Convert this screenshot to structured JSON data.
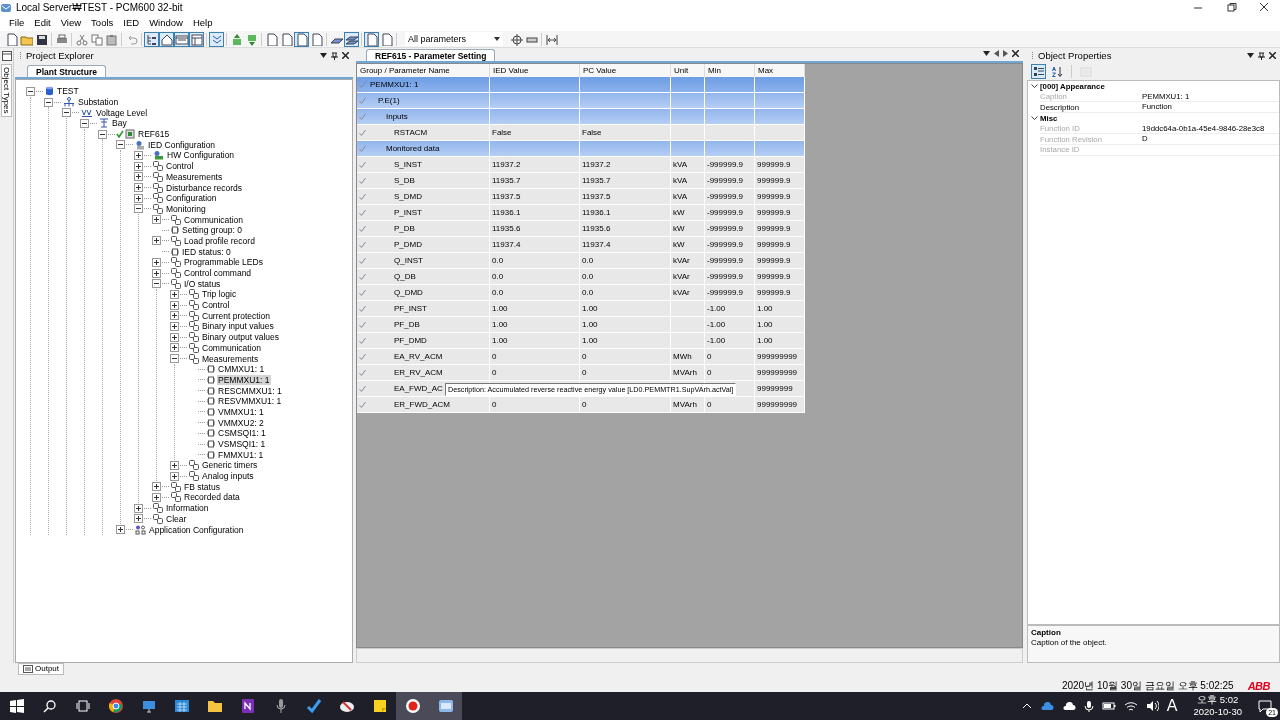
{
  "window": {
    "title": "Local Server₩TEST - PCM600 32-bit"
  },
  "menu": [
    "File",
    "Edit",
    "View",
    "Tools",
    "IED",
    "Window",
    "Help"
  ],
  "toolbar": {
    "buttons": [
      {
        "pressed": false
      },
      {
        "pressed": false
      },
      {
        "pressed": false
      },
      {
        "pressed": false
      },
      {
        "pressed": false
      },
      {
        "pressed": false
      },
      {
        "pressed": false
      },
      {
        "pressed": false
      },
      {
        "pressed": true
      },
      {
        "pressed": true
      },
      {
        "pressed": true
      },
      {
        "pressed": true
      },
      {
        "pressed": true
      },
      {
        "pressed": false
      },
      {
        "pressed": false
      },
      {
        "pressed": false
      },
      {
        "pressed": false
      },
      {
        "pressed": true
      },
      {
        "pressed": false
      },
      {
        "pressed": false
      },
      {
        "pressed": true
      },
      {
        "pressed": true
      },
      {
        "pressed": false
      }
    ],
    "filter": {
      "value": "All parameters"
    },
    "after": [
      {
        "pressed": false
      },
      {
        "pressed": false
      },
      {
        "pressed": false
      }
    ]
  },
  "side_strip": {
    "label": "Object Types"
  },
  "project_explorer": {
    "title": "Project Explorer",
    "tab": {
      "label": "Plant Structure",
      "selected": true
    },
    "tree": [
      {
        "label": "TEST",
        "kind": "database",
        "expanded": true,
        "selected": false,
        "children": [
          {
            "label": "Substation",
            "kind": "substation",
            "expanded": true,
            "selected": false,
            "children": [
              {
                "label": "Voltage Level",
                "kind": "voltage",
                "expanded": true,
                "selected": false,
                "children": [
                  {
                    "label": "Bay",
                    "kind": "bay",
                    "expanded": true,
                    "selected": false,
                    "children": [
                      {
                        "label": "REF615",
                        "kind": "ied",
                        "checked": true,
                        "expanded": true,
                        "selected": false,
                        "children": [
                          {
                            "label": "IED Configuration",
                            "kind": "config",
                            "expanded": true,
                            "selected": false,
                            "children": [
                              {
                                "label": "HW Configuration",
                                "kind": "hw",
                                "expanded": false,
                                "selected": false
                              },
                              {
                                "label": "Control",
                                "kind": "group",
                                "expanded": false,
                                "selected": false
                              },
                              {
                                "label": "Measurements",
                                "kind": "group",
                                "expanded": false,
                                "selected": false
                              },
                              {
                                "label": "Disturbance records",
                                "kind": "group",
                                "expanded": false,
                                "selected": false
                              },
                              {
                                "label": "Configuration",
                                "kind": "group",
                                "expanded": false,
                                "selected": false
                              },
                              {
                                "label": "Monitoring",
                                "kind": "group",
                                "expanded": true,
                                "selected": false,
                                "children": [
                                  {
                                    "label": "Communication",
                                    "kind": "group",
                                    "expanded": false,
                                    "selected": false
                                  },
                                  {
                                    "label": "Setting group: 0",
                                    "kind": "leaf",
                                    "selected": false
                                  },
                                  {
                                    "label": "Load profile record",
                                    "kind": "group",
                                    "expanded": false,
                                    "selected": false
                                  },
                                  {
                                    "label": "IED status: 0",
                                    "kind": "leaf",
                                    "selected": false
                                  },
                                  {
                                    "label": "Programmable LEDs",
                                    "kind": "group",
                                    "expanded": false,
                                    "selected": false
                                  },
                                  {
                                    "label": "Control command",
                                    "kind": "group",
                                    "expanded": false,
                                    "selected": false
                                  },
                                  {
                                    "label": "I/O status",
                                    "kind": "group",
                                    "expanded": true,
                                    "selected": false,
                                    "children": [
                                      {
                                        "label": "Trip logic",
                                        "kind": "group",
                                        "expanded": false,
                                        "selected": false
                                      },
                                      {
                                        "label": "Control",
                                        "kind": "group",
                                        "expanded": false,
                                        "selected": false
                                      },
                                      {
                                        "label": "Current protection",
                                        "kind": "group",
                                        "expanded": false,
                                        "selected": false
                                      },
                                      {
                                        "label": "Binary input values",
                                        "kind": "group",
                                        "expanded": false,
                                        "selected": false
                                      },
                                      {
                                        "label": "Binary output values",
                                        "kind": "group",
                                        "expanded": false,
                                        "selected": false
                                      },
                                      {
                                        "label": "Communication",
                                        "kind": "group",
                                        "expanded": false,
                                        "selected": false
                                      },
                                      {
                                        "label": "Measurements",
                                        "kind": "group",
                                        "expanded": true,
                                        "selected": false,
                                        "children": [
                                          {
                                            "label": "CMMXU1: 1",
                                            "kind": "leaf",
                                            "selected": false
                                          },
                                          {
                                            "label": "PEMMXU1: 1",
                                            "kind": "leaf",
                                            "selected": true
                                          },
                                          {
                                            "label": "RESCMMXU1: 1",
                                            "kind": "leaf",
                                            "selected": false
                                          },
                                          {
                                            "label": "RESVMMXU1: 1",
                                            "kind": "leaf",
                                            "selected": false
                                          },
                                          {
                                            "label": "VMMXU1: 1",
                                            "kind": "leaf",
                                            "selected": false
                                          },
                                          {
                                            "label": "VMMXU2: 2",
                                            "kind": "leaf",
                                            "selected": false
                                          },
                                          {
                                            "label": "CSMSQI1: 1",
                                            "kind": "leaf",
                                            "selected": false
                                          },
                                          {
                                            "label": "VSMSQI1: 1",
                                            "kind": "leaf",
                                            "selected": false
                                          },
                                          {
                                            "label": "FMMXU1: 1",
                                            "kind": "leaf",
                                            "selected": false
                                          }
                                        ]
                                      },
                                      {
                                        "label": "Generic timers",
                                        "kind": "group",
                                        "expanded": false,
                                        "selected": false
                                      },
                                      {
                                        "label": "Analog inputs",
                                        "kind": "group",
                                        "expanded": false,
                                        "selected": false
                                      }
                                    ]
                                  },
                                  {
                                    "label": "FB status",
                                    "kind": "group",
                                    "expanded": false,
                                    "selected": false
                                  },
                                  {
                                    "label": "Recorded data",
                                    "kind": "group",
                                    "expanded": false,
                                    "selected": false
                                  }
                                ]
                              },
                              {
                                "label": "Information",
                                "kind": "group",
                                "expanded": false,
                                "selected": false
                              },
                              {
                                "label": "Clear",
                                "kind": "group",
                                "expanded": false,
                                "selected": false
                              }
                            ]
                          },
                          {
                            "label": "Application Configuration",
                            "kind": "app",
                            "expanded": false,
                            "selected": false
                          }
                        ]
                      }
                    ]
                  }
                ]
              }
            ]
          }
        ]
      }
    ]
  },
  "document": {
    "tab": {
      "label": "REF615 - Parameter Setting",
      "selected": true
    },
    "columns": [
      "Group / Parameter Name",
      "IED Value",
      "PC Value",
      "Unit",
      "Min",
      "Max"
    ],
    "rows": [
      {
        "kind": "group",
        "name": "PEMMXU1: 1",
        "children": [
          {
            "kind": "group",
            "name": "P.E(1)",
            "children": [
              {
                "kind": "group",
                "name": "Inputs",
                "children": [
                  {
                    "kind": "param",
                    "name": "RSTACM",
                    "ied_value": "False",
                    "pc_value": "False"
                  }
                ]
              },
              {
                "kind": "group",
                "name": "Monitored data",
                "children": [
                  {
                    "kind": "param",
                    "name": "S_INST",
                    "ied_value": "11937.2",
                    "pc_value": "11937.2",
                    "unit": "kVA",
                    "min": "-999999.9",
                    "max": "999999.9"
                  },
                  {
                    "kind": "param",
                    "name": "S_DB",
                    "ied_value": "11935.7",
                    "pc_value": "11935.7",
                    "unit": "kVA",
                    "min": "-999999.9",
                    "max": "999999.9"
                  },
                  {
                    "kind": "param",
                    "name": "S_DMD",
                    "ied_value": "11937.5",
                    "pc_value": "11937.5",
                    "unit": "kVA",
                    "min": "-999999.9",
                    "max": "999999.9"
                  },
                  {
                    "kind": "param",
                    "name": "P_INST",
                    "ied_value": "11936.1",
                    "pc_value": "11936.1",
                    "unit": "kW",
                    "min": "-999999.9",
                    "max": "999999.9"
                  },
                  {
                    "kind": "param",
                    "name": "P_DB",
                    "ied_value": "11935.6",
                    "pc_value": "11935.6",
                    "unit": "kW",
                    "min": "-999999.9",
                    "max": "999999.9"
                  },
                  {
                    "kind": "param",
                    "name": "P_DMD",
                    "ied_value": "11937.4",
                    "pc_value": "11937.4",
                    "unit": "kW",
                    "min": "-999999.9",
                    "max": "999999.9"
                  },
                  {
                    "kind": "param",
                    "name": "Q_INST",
                    "ied_value": "0.0",
                    "pc_value": "0.0",
                    "unit": "kVAr",
                    "min": "-999999.9",
                    "max": "999999.9"
                  },
                  {
                    "kind": "param",
                    "name": "Q_DB",
                    "ied_value": "0.0",
                    "pc_value": "0.0",
                    "unit": "kVAr",
                    "min": "-999999.9",
                    "max": "999999.9"
                  },
                  {
                    "kind": "param",
                    "name": "Q_DMD",
                    "ied_value": "0.0",
                    "pc_value": "0.0",
                    "unit": "kVAr",
                    "min": "-999999.9",
                    "max": "999999.9"
                  },
                  {
                    "kind": "param",
                    "name": "PF_INST",
                    "ied_value": "1.00",
                    "pc_value": "1.00",
                    "min": "-1.00",
                    "max": "1.00"
                  },
                  {
                    "kind": "param",
                    "name": "PF_DB",
                    "ied_value": "1.00",
                    "pc_value": "1.00",
                    "min": "-1.00",
                    "max": "1.00"
                  },
                  {
                    "kind": "param",
                    "name": "PF_DMD",
                    "ied_value": "1.00",
                    "pc_value": "1.00",
                    "min": "-1.00",
                    "max": "1.00"
                  },
                  {
                    "kind": "param",
                    "name": "EA_RV_ACM",
                    "ied_value": "0",
                    "pc_value": "0",
                    "unit": "MWh",
                    "min": "0",
                    "max": "999999999"
                  },
                  {
                    "kind": "param",
                    "name": "ER_RV_ACM",
                    "ied_value": "0",
                    "pc_value": "0",
                    "unit": "MVArh",
                    "min": "0",
                    "max": "999999999"
                  },
                  {
                    "kind": "param",
                    "name": "EA_FWD_AC",
                    "max": "99999999",
                    "tooltip": "Description: Accumulated reverse reactive energy value [LD0.PEMMTR1.SupVArh.actVal]"
                  },
                  {
                    "kind": "param",
                    "name": "ER_FWD_ACM",
                    "ied_value": "0",
                    "pc_value": "0",
                    "unit": "MVArh",
                    "min": "0",
                    "max": "999999999"
                  }
                ]
              }
            ]
          }
        ]
      }
    ]
  },
  "object_properties": {
    "title": "Object Properties",
    "toolbar": [
      {
        "pressed": true,
        "disabled": false
      },
      {
        "pressed": false,
        "disabled": false
      },
      {
        "pressed": false,
        "disabled": true
      }
    ],
    "categories": [
      {
        "name": "[000] Appearance",
        "expanded": true,
        "properties": [
          {
            "name": "Caption",
            "value": "PEMMXU1: 1",
            "readonly": true
          },
          {
            "name": "Description",
            "value": "Function",
            "readonly": false
          }
        ]
      },
      {
        "name": "Misc",
        "expanded": true,
        "properties": [
          {
            "name": "Function ID",
            "value": "19ddc64a-0b1a-45e4-9846-28e3c8",
            "readonly": true
          },
          {
            "name": "Function Revision",
            "value": "D",
            "readonly": true
          },
          {
            "name": "Instance ID",
            "readonly": true
          }
        ]
      }
    ],
    "description": {
      "title": "Caption",
      "text": "Caption of the object."
    }
  },
  "output_tab": {
    "label": "Output"
  },
  "status_bar": {
    "datetime": "2020년 10월 30일 금요일 오후 5:02:25",
    "logo": "ABB"
  },
  "taskbar": {
    "apps": [
      {
        "active": false
      },
      {
        "active": false
      },
      {
        "active": false
      },
      {
        "active": false
      },
      {
        "active": false
      },
      {
        "active": false
      },
      {
        "active": false
      },
      {
        "active": false
      },
      {
        "active": false
      },
      {
        "active": true
      },
      {
        "active": true
      }
    ],
    "input_mode": "A",
    "time": "오후 5:02",
    "date": "2020-10-30",
    "notifications": "21"
  }
}
